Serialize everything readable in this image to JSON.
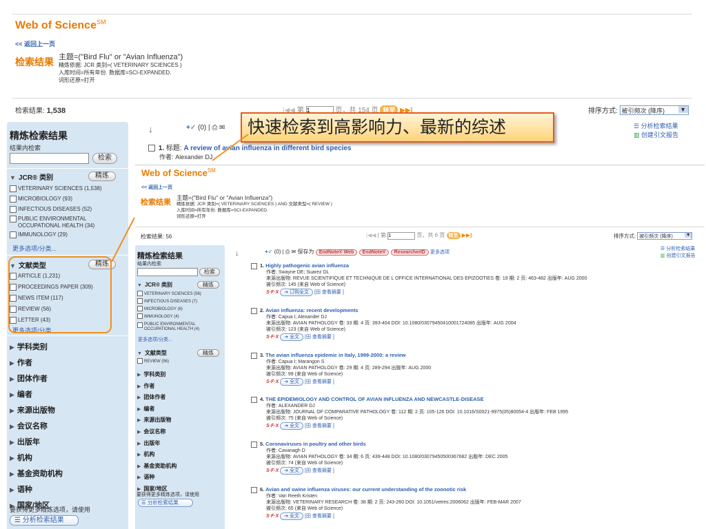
{
  "outer": {
    "brand": "Web of Science",
    "brand_sup": "SM",
    "back_link": "<< 返回上一页",
    "results_label": "检索结果",
    "query_lines": [
      "主题=(\"Bird Flu\" or \"Avian Influenza\")",
      "精炼依据: JCR 类别=( VETERINARY SCIENCES )",
      "入库时间=所有年份. 数据库=SCI-EXPANDED.",
      "词形还原=打开"
    ],
    "count_label": "检索结果:",
    "count": "1,538",
    "page_prefix": "第",
    "page_value": "1",
    "page_suffix": "页，共 154 页",
    "go_label": "转至",
    "sort_label": "排序方式:",
    "sort_value": "被引频次 (降序)",
    "refine_title": "精炼检索结果",
    "within_label": "结果内检索",
    "search_btn": "检索",
    "refine_btn": "精炼",
    "jcr_title": "JCR® 类别",
    "jcr_items": [
      "VETERINARY SCIENCES (1,538)",
      "MICROBIOLOGY (93)",
      "INFECTIOUS DISEASES (52)",
      "PUBLIC ENVIRONMENTAL OCCUPATIONAL HEALTH (34)",
      "IMMUNOLOGY (29)"
    ],
    "more_link": "更多选项/分类...",
    "doctype_title": "文献类型",
    "doctype_items": [
      "ARTICLE (1,231)",
      "PROCEEDINGS PAPER (309)",
      "NEWS ITEM (117)",
      "REVIEW (56)",
      "LETTER (43)"
    ],
    "facets": [
      "学科类别",
      "作者",
      "团体作者",
      "编者",
      "来源出版物",
      "会议名称",
      "出版年",
      "机构",
      "基金资助机构",
      "语种",
      "国家/地区"
    ],
    "footer_note": "要获得更多精炼选项，请使用",
    "analyze_btn": "分析检索结果",
    "marked_count": "(0)",
    "analyze_link": "分析检索结果",
    "citation_link": "创建引文报告",
    "rec1_num": "1.",
    "rec1_title_label": "标题:",
    "rec1_title": "A review of avian influenza in different bird species",
    "rec1_author_label": "作者:",
    "rec1_author": "Alexander DJ"
  },
  "callout": "快速检索到高影响力、最新的综述",
  "inner": {
    "brand": "Web of Science",
    "brand_sup": "SM",
    "back_link": "<< 返回上一页",
    "results_label": "检索结果",
    "query_lines": [
      "主题=(\"Bird Flu\" or \"Avian Influenza\")",
      "精炼依据: JCR 类别=( VETERINARY SCIENCES ) AND 文献类型=( REVIEW )",
      "入库时间=所有年份. 数据库=SCI-EXPANDED.",
      "词形还原=打开"
    ],
    "count_label": "检索结果:",
    "count": "56",
    "page_prefix": "第",
    "page_value": "1",
    "page_suffix": "页，共 6 页",
    "go_label": "转至",
    "sort_label": "排序方式:",
    "sort_value": "被引频次 (降序)",
    "refine_title": "精炼检索结果",
    "within_label": "结果内检索",
    "search_btn": "检索",
    "refine_btn": "精炼",
    "jcr_title": "JCR® 类别",
    "jcr_items": [
      "VETERINARY SCIENCES (56)",
      "INFECTIOUS DISEASES (7)",
      "MICROBIOLOGY (6)",
      "IMMUNOLOGY (4)",
      "PUBLIC ENVIRONMENTAL OCCUPATIONAL HEALTH (4)"
    ],
    "more_link": "更多选项/分类...",
    "doctype_title": "文献类型",
    "doctype_items": [
      "REVIEW (56)"
    ],
    "facets": [
      "学科类别",
      "作者",
      "团体作者",
      "编者",
      "来源出版物",
      "会议名称",
      "出版年",
      "机构",
      "基金资助机构",
      "语种",
      "国家/地区"
    ],
    "footer_note": "要获得更多精炼选项，请使用",
    "analyze_btn": "分析检索结果",
    "marked_count": "(0)",
    "save_to": "保存为",
    "endnote_web": "EndNote® Web",
    "endnote": "EndNote®",
    "researcherid": "ResearcherID",
    "more_options": "更多选项",
    "analyze_link": "分析检索结果",
    "citation_link": "创建引文报告",
    "sfx": "S·F·X",
    "fulltext": "全文",
    "order_fulltext": "订购全文",
    "abstract_link": "[田 查看摘要 ]",
    "records": [
      {
        "num": "1.",
        "title": "Highly pathogenic avian influenza",
        "author": "作者: Swayne DE; Suarez DL",
        "source": "来源出版物: REVUE SCIENTIFIQUE ET TECHNIQUE DE L OFFICE INTERNATIONAL DES EPIZOOTIES 卷: 19 期: 2 页: 463-482 出版年: AUG 2000",
        "cited": "被引频次: 145 (来自 Web of Science)"
      },
      {
        "num": "2.",
        "title": "Avian influenza: recent developments",
        "author": "作者: Capua I; Alexander DJ",
        "source": "来源出版物: AVIAN PATHOLOGY 卷: 33 期: 4 页: 393-404 DOI: 10.1080/03079450410001724085 出版年: AUG 2004",
        "cited": "被引频次: 123 (来自 Web of Science)"
      },
      {
        "num": "3.",
        "title": "The avian influenza epidemic in Italy, 1999-2000: a review",
        "author": "作者: Capua I; Marangon S",
        "source": "来源出版物: AVIAN PATHOLOGY 卷: 29 期: 4 页: 289-294 出版年: AUG 2000",
        "cited": "被引频次: 99 (来自 Web of Science)"
      },
      {
        "num": "4.",
        "title": "THE EPIDEMIOLOGY AND CONTROL OF AVIAN INFLUENZA AND NEWCASTLE-DISEASE",
        "author": "作者: ALEXANDER DJ",
        "source": "来源出版物: JOURNAL OF COMPARATIVE PATHOLOGY 卷: 112 期: 2 页: 105-126 DOI: 10.1016/S0021-9975(05)80054-4 出版年: FEB 1995",
        "cited": "被引频次: 75 (来自 Web of Science)"
      },
      {
        "num": "5.",
        "title": "Coronaviruses in poultry and other birds",
        "author": "作者: Cavanagh D",
        "source": "来源出版物: AVIAN PATHOLOGY 卷: 34 期: 6 页: 439-448 DOI: 10.1080/03079450500367682 出版年: DEC 2005",
        "cited": "被引频次: 74 (来自 Web of Science)"
      },
      {
        "num": "6.",
        "title": "Avian and swine influenza viruses: our current understanding of the zoonotic risk",
        "author": "作者: Van Reeth Kristen",
        "source": "来源出版物: VETERINARY RESEARCH 卷: 38 期: 2 页: 243-260 DOI: 10.1051/vetres:2006062 出版年: FEB-MAR 2007",
        "cited": "被引频次: 65 (来自 Web of Science)"
      }
    ]
  },
  "colors": {
    "orange_brand": "#e87a00",
    "callout_border": "#e85a1c",
    "sidebar_bg": "#d7e6f3",
    "link_blue": "#2d5fb0"
  }
}
